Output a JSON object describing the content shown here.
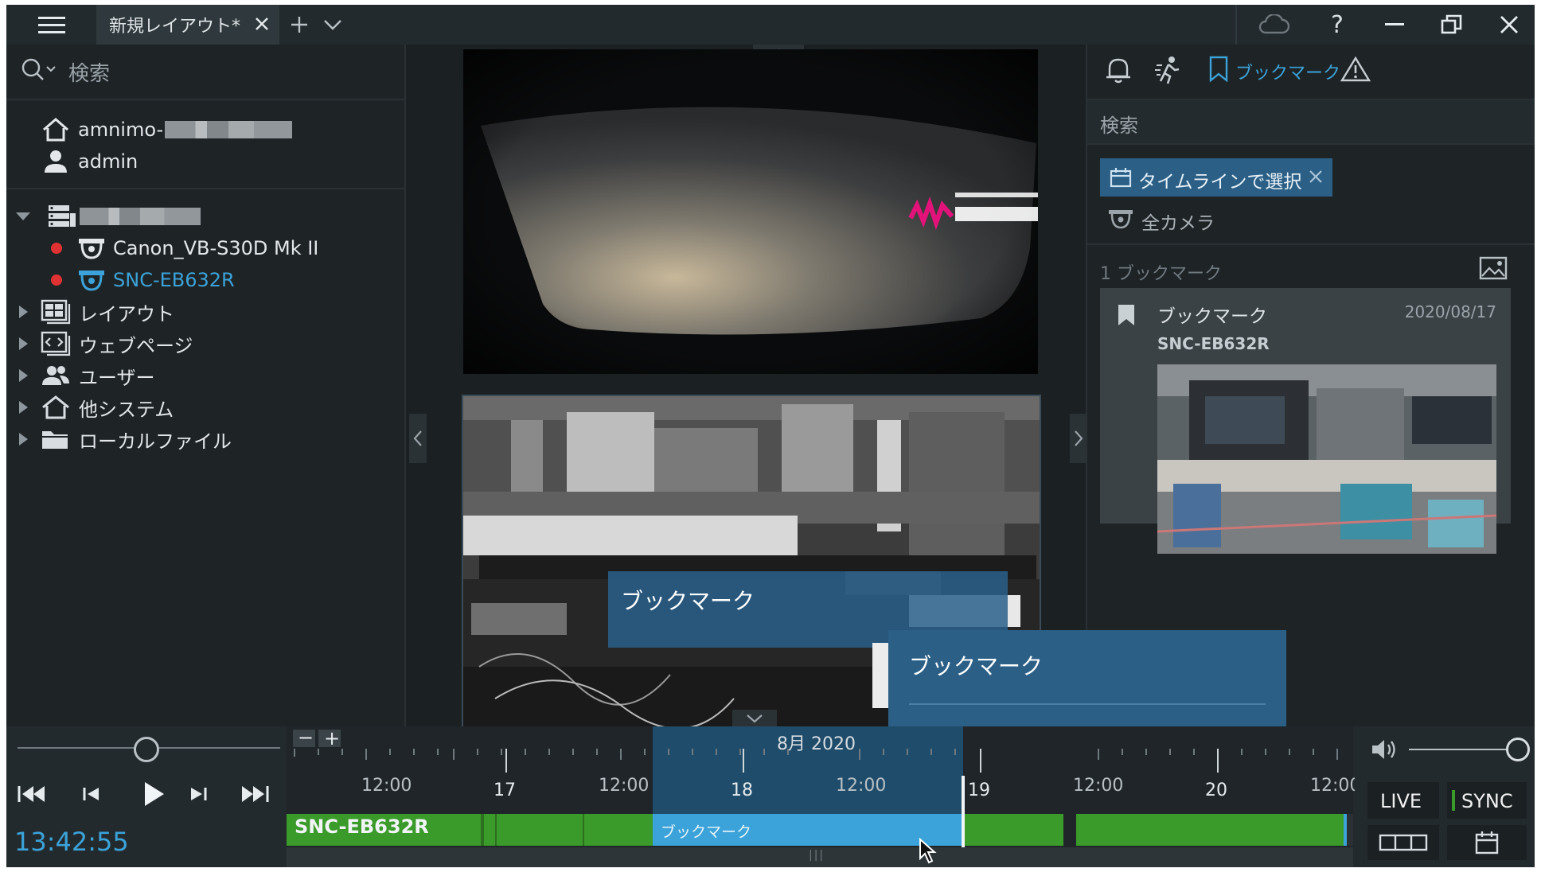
{
  "titlebar": {
    "tab_label": "新規レイアウト*",
    "menu_icon": "hamburger-icon",
    "close_tab_icon": "close-icon",
    "add_tab_icon": "plus-icon",
    "tab_dropdown_icon": "chevron-down-icon",
    "cloud_icon": "cloud-icon",
    "help_label": "?",
    "minimize_icon": "minimize-icon",
    "restore_icon": "restore-icon",
    "close_icon": "close-icon"
  },
  "left_panel": {
    "search_placeholder": "検索",
    "site_name": "amnimo-",
    "user_name": "admin",
    "server_group_expanded": true,
    "cameras": [
      {
        "name": "Canon_VB-S30D Mk II",
        "recording": true,
        "selected": false
      },
      {
        "name": "SNC-EB632R",
        "recording": true,
        "selected": true
      }
    ],
    "tree_items": [
      {
        "label": "レイアウト",
        "icon": "layout-icon"
      },
      {
        "label": "ウェブページ",
        "icon": "webpage-icon"
      },
      {
        "label": "ユーザー",
        "icon": "users-icon"
      },
      {
        "label": "他システム",
        "icon": "other-system-icon"
      },
      {
        "label": "ローカルファイル",
        "icon": "folder-icon"
      }
    ]
  },
  "center": {
    "camera_view_2_bookmark_label": "ブックマーク",
    "bookmark_popup": {
      "title": "ブックマーク",
      "actions": [
        "play-icon",
        "edit-icon",
        "download-icon",
        "trash-icon"
      ]
    }
  },
  "right_panel": {
    "tabs": [
      {
        "icon": "bell-icon",
        "label": ""
      },
      {
        "icon": "motion-icon",
        "label": ""
      },
      {
        "icon": "bookmark-icon",
        "label": "ブックマーク",
        "active": true
      },
      {
        "icon": "warning-icon",
        "label": ""
      }
    ],
    "search_placeholder": "検索",
    "filter_chip": "タイムラインで選択",
    "all_cameras": "全カメラ",
    "count_label": "1 ブックマーク",
    "bookmark_card": {
      "title": "ブックマーク",
      "date": "2020/08/17",
      "camera": "SNC-EB632R"
    }
  },
  "bottom": {
    "time": "13:42:55",
    "zoom_minus": "−",
    "zoom_plus": "+",
    "month_label": "8月 2020",
    "tick_labels": [
      "12:00",
      "17",
      "12:00",
      "18",
      "12:00",
      "19",
      "12:00",
      "20",
      "12:00"
    ],
    "camera_track": "SNC-EB632R",
    "bookmark_segment": "ブックマーク",
    "live": "LIVE",
    "sync": "SYNC",
    "accent": "#3ba3d9",
    "recording_color": "#3a9a2a"
  }
}
